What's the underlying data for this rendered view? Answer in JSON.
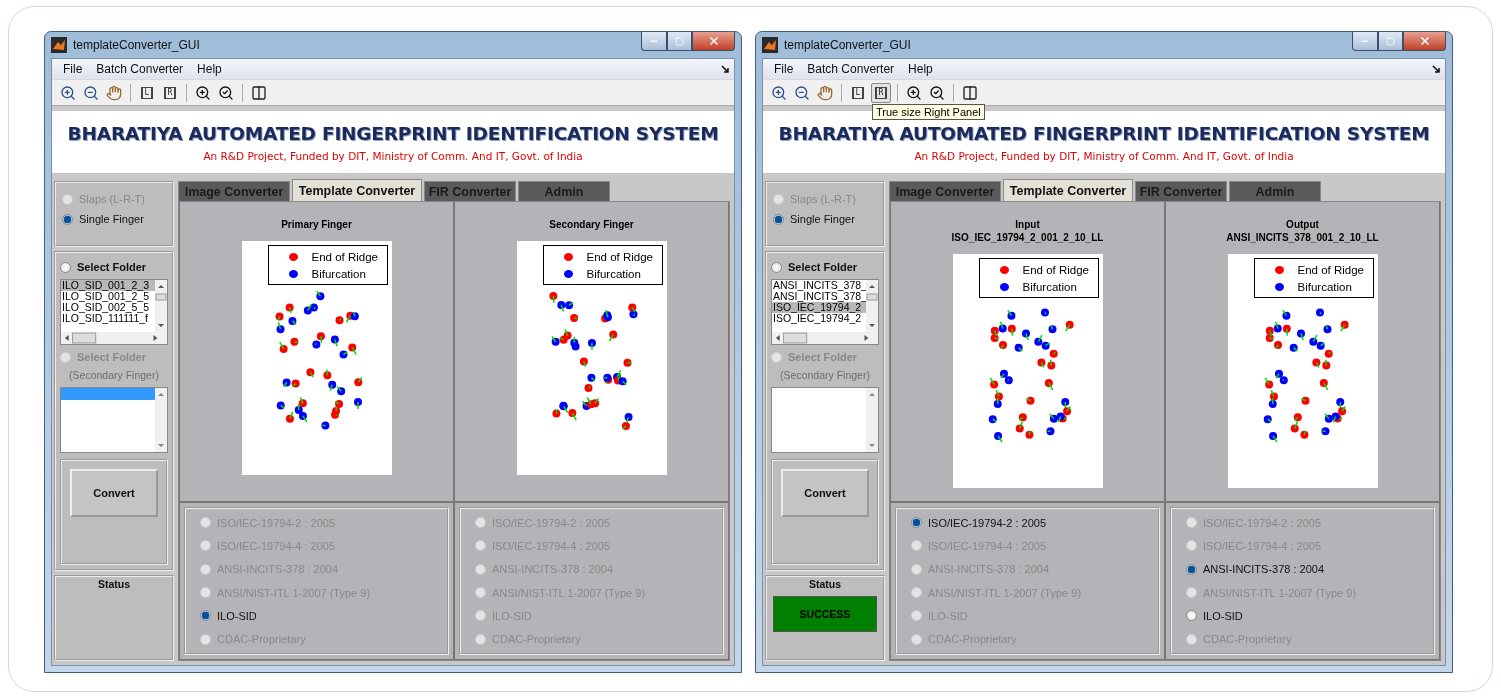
{
  "windows": [
    {
      "title": "templateConverter_GUI",
      "menu": [
        "File",
        "Batch Converter",
        "Help"
      ],
      "toolbar": [
        {
          "kind": "zoom-in"
        },
        {
          "kind": "zoom-out"
        },
        {
          "kind": "pan"
        },
        {
          "kind": "separator"
        },
        {
          "kind": "frame",
          "label": "L",
          "pressed": false
        },
        {
          "kind": "frame",
          "label": "R",
          "pressed": false
        },
        {
          "kind": "separator"
        },
        {
          "kind": "zoom-plus"
        },
        {
          "kind": "zoom-reset"
        },
        {
          "kind": "separator"
        },
        {
          "kind": "layout"
        }
      ],
      "banner": {
        "title": "BHARATIYA AUTOMATED FINGERPRINT IDENTIFICATION SYSTEM",
        "subtitle": "An R&D Project, Funded by DIT, Ministry of Comm. And IT, Govt. of India"
      },
      "mode_options": [
        {
          "label": "Slaps (L-R-T)",
          "selected": false,
          "disabled": true
        },
        {
          "label": "Single Finger",
          "selected": true,
          "disabled": false
        }
      ],
      "primary_folder": {
        "label": "Select Folder",
        "selected": false,
        "disabled": false
      },
      "primary_files": [
        {
          "name": "ILO_SID_001_2_3",
          "selected": true
        },
        {
          "name": "ILO_SID_001_2_5",
          "selected": false
        },
        {
          "name": "ILO_SID_002_5_5",
          "selected": false
        },
        {
          "name": "ILO_SID_111111_f",
          "selected": false
        }
      ],
      "secondary_folder": {
        "label": "Select Folder",
        "note": "(Secondary Finger)",
        "selected": false,
        "disabled": true
      },
      "secondary_list_highlighted": true,
      "convert": "Convert",
      "status": {
        "label": "Status"
      },
      "tabs": [
        {
          "label": "Image Converter",
          "selected": false
        },
        {
          "label": "Template Converter",
          "selected": true
        },
        {
          "label": "FIR Converter",
          "selected": false
        },
        {
          "label": "Admin",
          "selected": false
        }
      ],
      "panels": [
        {
          "titles": [
            "Primary Finger"
          ],
          "legend": [
            {
              "label": "End of Ridge",
              "color": "#ff0000"
            },
            {
              "label": "Bifurcation",
              "color": "#0000ff"
            }
          ],
          "formats": [
            {
              "label": "ISO/IEC-19794-2 : 2005",
              "selected": false,
              "disabled": true
            },
            {
              "label": "ISO/IEC-19794-4 : 2005",
              "selected": false,
              "disabled": true
            },
            {
              "label": "ANSI-INCITS-378 : 2004",
              "selected": false,
              "disabled": true
            },
            {
              "label": "ANSI/NIST-ITL 1-2007 (Type 9)",
              "selected": false,
              "disabled": true
            },
            {
              "label": "ILO-SID",
              "selected": true,
              "disabled": false
            },
            {
              "label": "CDAC-Proprietary",
              "selected": false,
              "disabled": true
            }
          ]
        },
        {
          "titles": [
            "Secondary Finger"
          ],
          "legend": [
            {
              "label": "End of Ridge",
              "color": "#ff0000"
            },
            {
              "label": "Bifurcation",
              "color": "#0000ff"
            }
          ],
          "formats": [
            {
              "label": "ISO/IEC-19794-2 : 2005",
              "selected": false,
              "disabled": true
            },
            {
              "label": "ISO/IEC-19794-4 : 2005",
              "selected": false,
              "disabled": true
            },
            {
              "label": "ANSI-INCITS-378 : 2004",
              "selected": false,
              "disabled": true
            },
            {
              "label": "ANSI/NIST-ITL 1-2007 (Type 9)",
              "selected": false,
              "disabled": true
            },
            {
              "label": "ILO-SID",
              "selected": false,
              "disabled": true
            },
            {
              "label": "CDAC-Proprietary",
              "selected": false,
              "disabled": true
            }
          ]
        }
      ]
    },
    {
      "title": "templateConverter_GUI",
      "menu": [
        "File",
        "Batch Converter",
        "Help"
      ],
      "toolbar": [
        {
          "kind": "zoom-in"
        },
        {
          "kind": "zoom-out"
        },
        {
          "kind": "pan"
        },
        {
          "kind": "separator"
        },
        {
          "kind": "frame",
          "label": "L",
          "pressed": false
        },
        {
          "kind": "frame",
          "label": "R",
          "pressed": true,
          "tooltip": "True size Right Panel"
        },
        {
          "kind": "separator"
        },
        {
          "kind": "zoom-plus"
        },
        {
          "kind": "zoom-reset"
        },
        {
          "kind": "separator"
        },
        {
          "kind": "layout"
        }
      ],
      "banner": {
        "title": "BHARATIYA AUTOMATED FINGERPRINT IDENTIFICATION SYSTEM",
        "subtitle": "An R&D Project, Funded by DIT, Ministry of Comm. And IT, Govt. of India"
      },
      "mode_options": [
        {
          "label": "Slaps (L-R-T)",
          "selected": false,
          "disabled": true
        },
        {
          "label": "Single Finger",
          "selected": true,
          "disabled": false
        }
      ],
      "primary_folder": {
        "label": "Select Folder",
        "selected": false,
        "disabled": false
      },
      "primary_files": [
        {
          "name": "ANSI_INCITS_378_",
          "selected": false
        },
        {
          "name": "ANSI_INCITS_378_",
          "selected": false
        },
        {
          "name": "ISO_IEC_19794_2",
          "selected": true
        },
        {
          "name": "ISO_IEC_19794_2",
          "selected": false
        }
      ],
      "secondary_folder": {
        "label": "Select Folder",
        "note": "(Secondary Finger)",
        "selected": false,
        "disabled": true
      },
      "secondary_list_highlighted": false,
      "convert": "Convert",
      "status": {
        "label": "Status",
        "value": "SUCCESS"
      },
      "tabs": [
        {
          "label": "Image Converter",
          "selected": false
        },
        {
          "label": "Template Converter",
          "selected": true
        },
        {
          "label": "FIR Converter",
          "selected": false
        },
        {
          "label": "Admin",
          "selected": false
        }
      ],
      "panels": [
        {
          "titles": [
            "Input",
            "ISO_IEC_19794_2_001_2_10_LL"
          ],
          "legend": [
            {
              "label": "End of Ridge",
              "color": "#ff0000"
            },
            {
              "label": "Bifurcation",
              "color": "#0000ff"
            }
          ],
          "formats": [
            {
              "label": "ISO/IEC-19794-2 : 2005",
              "selected": true,
              "disabled": false
            },
            {
              "label": "ISO/IEC-19794-4 : 2005",
              "selected": false,
              "disabled": true
            },
            {
              "label": "ANSI-INCITS-378 : 2004",
              "selected": false,
              "disabled": true
            },
            {
              "label": "ANSI/NIST-ITL 1-2007 (Type 9)",
              "selected": false,
              "disabled": true
            },
            {
              "label": "ILO-SID",
              "selected": false,
              "disabled": true
            },
            {
              "label": "CDAC-Proprietary",
              "selected": false,
              "disabled": true
            }
          ]
        },
        {
          "titles": [
            "Output",
            "ANSI_INCITS_378_001_2_10_LL"
          ],
          "legend": [
            {
              "label": "End of Ridge",
              "color": "#ff0000"
            },
            {
              "label": "Bifurcation",
              "color": "#0000ff"
            }
          ],
          "formats": [
            {
              "label": "ISO/IEC-19794-2 : 2005",
              "selected": false,
              "disabled": true
            },
            {
              "label": "ISO/IEC-19794-4 : 2005",
              "selected": false,
              "disabled": true
            },
            {
              "label": "ANSI-INCITS-378 : 2004",
              "selected": true,
              "disabled": false
            },
            {
              "label": "ANSI/NIST-ITL 1-2007 (Type 9)",
              "selected": false,
              "disabled": true
            },
            {
              "label": "ILO-SID",
              "selected": false,
              "disabled": false
            },
            {
              "label": "CDAC-Proprietary",
              "selected": false,
              "disabled": true
            }
          ]
        }
      ]
    }
  ]
}
